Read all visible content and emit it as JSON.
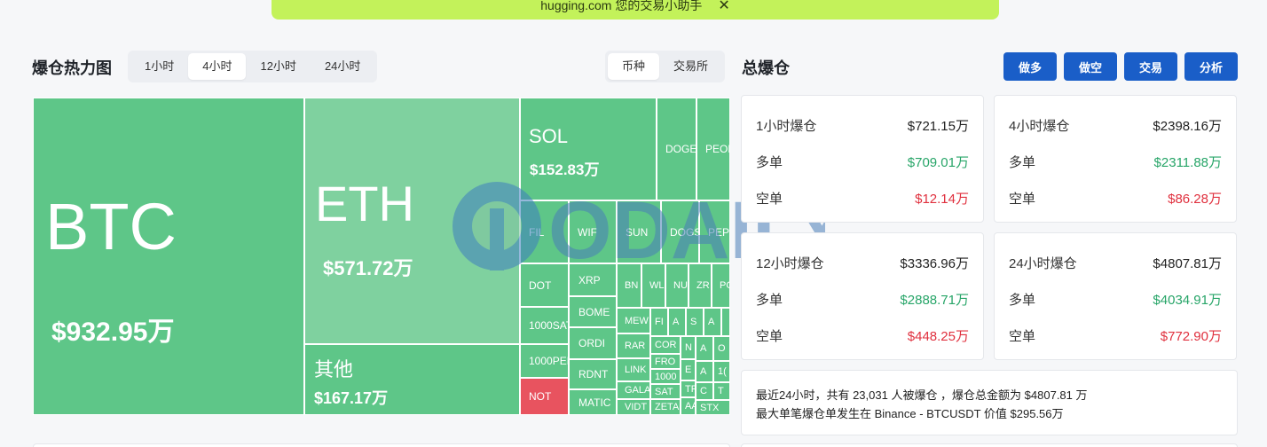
{
  "banner": {
    "text": "hugging.com 您的交易小助手",
    "close": "✕"
  },
  "heatmap": {
    "title": "爆仓热力图",
    "time_tabs": [
      "1小时",
      "4小时",
      "12小时",
      "24小时"
    ],
    "type_tabs": [
      "币种",
      "交易所"
    ],
    "cells": {
      "btc": {
        "name": "BTC",
        "value": "$932.95万"
      },
      "eth": {
        "name": "ETH",
        "value": "$571.72万"
      },
      "other": {
        "name": "其他",
        "value": "$167.17万"
      },
      "sol": {
        "name": "SOL",
        "value": "$152.83万"
      },
      "doge": "DOGE",
      "peop": "PEOP",
      "fil": "FIL",
      "wif": "WIF",
      "sun": "SUN",
      "dogs": "DOGS",
      "pepe": "PEPE",
      "dot": "DOT",
      "sats1000": "1000SAT",
      "pepe1000": "1000PEP",
      "not": "NOT",
      "xrp": "XRP",
      "bome": "BOME",
      "ordi": "ORDI",
      "rdnt": "RDNT",
      "matic": "MATIC",
      "bn": "BN",
      "wl": "WL",
      "nu": "NU",
      "zr": "ZR",
      "po": "PO",
      "mew": "MEW",
      "rar": "RAR",
      "link": "LINK",
      "gala": "GALA",
      "vidt": "VIDT",
      "f": "FI",
      "a1": "A",
      "s": "S",
      "a2": "A",
      "cor": "COR",
      "fro": "FRO",
      "k1000": "1000",
      "sat": "SAT",
      "zeta": "ZETA",
      "n": "N",
      "e": "E",
      "tr": "TR",
      "aa": "AA",
      "a3": "A",
      "a4": "A",
      "c": "C",
      "stx": "STX",
      "o": "O",
      "n16": "1(",
      "t": "T"
    }
  },
  "total": {
    "title": "总爆仓",
    "buttons": [
      "做多",
      "做空",
      "交易",
      "分析"
    ],
    "cards": [
      {
        "title": "1小时爆仓",
        "total": "$721.15万",
        "long_label": "多单",
        "long": "$709.01万",
        "short_label": "空单",
        "short": "$12.14万"
      },
      {
        "title": "4小时爆仓",
        "total": "$2398.16万",
        "long_label": "多单",
        "long": "$2311.88万",
        "short_label": "空单",
        "short": "$86.28万"
      },
      {
        "title": "12小时爆仓",
        "total": "$3336.96万",
        "long_label": "多单",
        "long": "$2888.71万",
        "short_label": "空单",
        "short": "$448.25万"
      },
      {
        "title": "24小时爆仓",
        "total": "$4807.81万",
        "long_label": "多单",
        "long": "$4034.91万",
        "short_label": "空单",
        "short": "$772.90万"
      }
    ],
    "summary_line1": "最近24小时，共有 23,031 人被爆仓 ，爆仓总金额为 $4807.81 万",
    "summary_line2": "最大单笔爆仓单发生在 Binance - BTCUSDT 价值 $295.56万"
  },
  "watermark": {
    "text": "ODAILY"
  },
  "colors": {
    "long_green": "#27a568",
    "short_red": "#e0303e",
    "button_blue": "#1a5ec8",
    "banner": "#c3f25a"
  }
}
